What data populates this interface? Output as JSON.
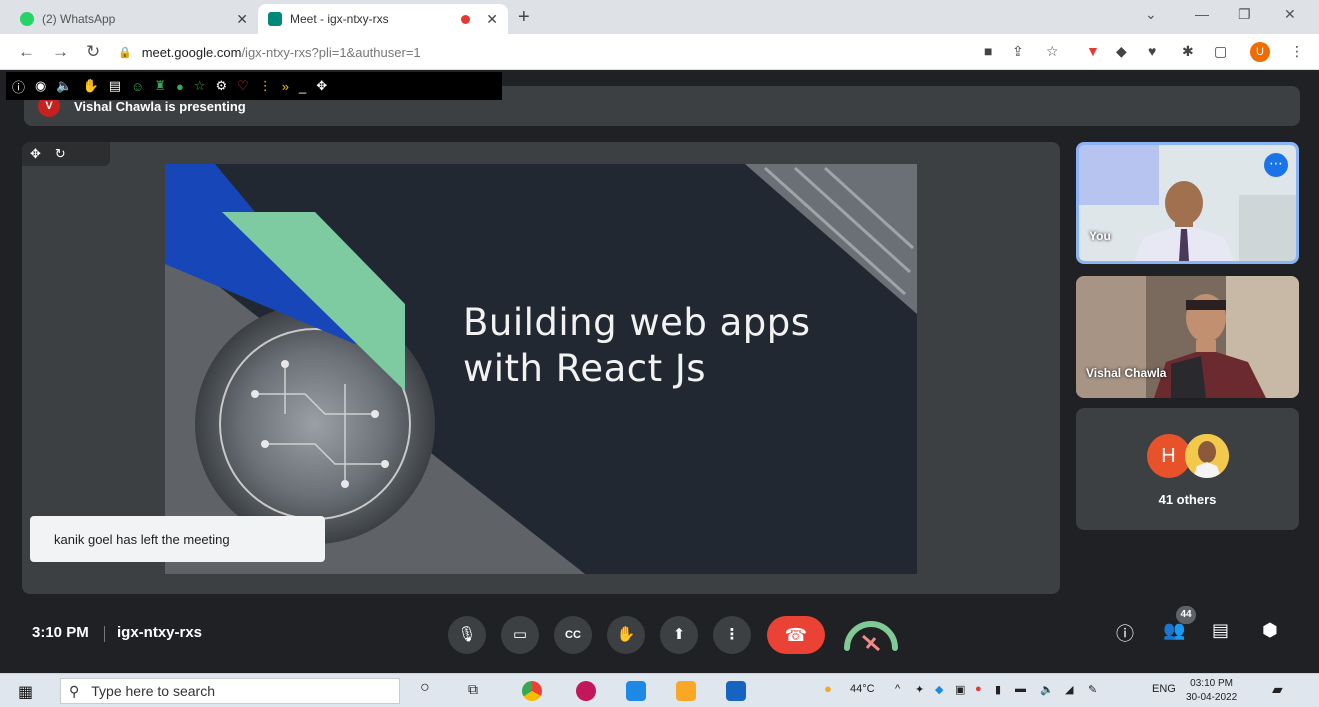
{
  "browser": {
    "tabs": [
      {
        "title": "(2) WhatsApp",
        "active": false
      },
      {
        "title": "Meet - igx-ntxy-rxs",
        "active": true
      }
    ],
    "url_host": "meet.google.com",
    "url_path": "/igx-ntxy-rxs?pli=1&authuser=1",
    "profile_initial": "U"
  },
  "meet": {
    "presenting_initial": "V",
    "presenting_text": "Vishal Chawla is presenting",
    "slide_title_line1": "Building web apps",
    "slide_title_line2": "with React Js",
    "toast": "kanik goel has left the meeting",
    "tiles": [
      {
        "label": "You"
      },
      {
        "label": "Vishal Chawla"
      }
    ],
    "others_initial": "H",
    "others_label": "41 others",
    "time": "3:10 PM",
    "code": "igx-ntxy-rxs",
    "participant_count": "44"
  },
  "taskbar": {
    "search_placeholder": "Type here to search",
    "temperature": "44°C",
    "language": "ENG",
    "clock_time": "03:10 PM",
    "clock_date": "30-04-2022"
  },
  "colors": {
    "meet_bg": "#202124",
    "tile_bg": "#3c4043",
    "end_call": "#ea4335",
    "active_speaker": "#8ab4f8",
    "slide_blue": "#1646b8",
    "slide_green": "#7ecba1"
  }
}
